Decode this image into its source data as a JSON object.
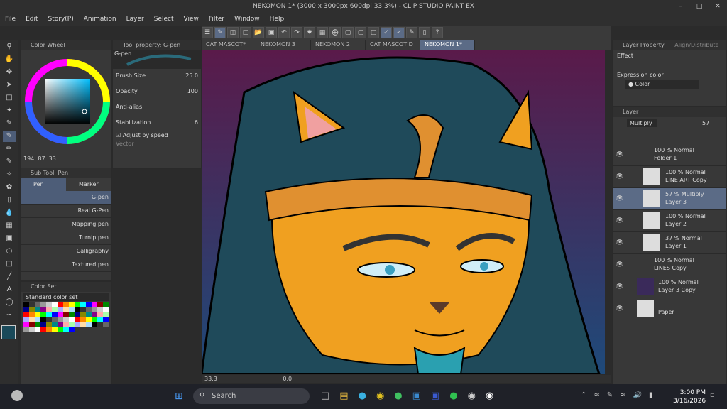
{
  "window": {
    "title": "NEKOMON 1* (3000 x 3000px 600dpi 33.3%) - CLIP STUDIO PAINT EX"
  },
  "menu": [
    "File",
    "Edit",
    "Story(P)",
    "Animation",
    "Layer",
    "Select",
    "View",
    "Filter",
    "Window",
    "Help"
  ],
  "tabs": [
    {
      "label": "CAT MASCOT*",
      "active": false
    },
    {
      "label": "NEKOMON 3",
      "active": false
    },
    {
      "label": "NEKOMON 2",
      "active": false
    },
    {
      "label": "CAT MASCOT D",
      "active": false
    },
    {
      "label": "NEKOMON 1*",
      "active": true
    }
  ],
  "color_wheel": {
    "title": "Color Wheel",
    "h": "194",
    "s": "87",
    "v": "33"
  },
  "tool_property": {
    "title": "Tool property: G-pen",
    "brush_name": "G-pen",
    "brush_size_label": "Brush Size",
    "brush_size_value": "25.0",
    "opacity_label": "Opacity",
    "opacity_value": "100",
    "anti_label": "Anti-aliasi",
    "stab_label": "Stabilization",
    "stab_value": "6",
    "adjust_label": "Adjust by speed",
    "vector_label": "Vector"
  },
  "sub_tool": {
    "title": "Sub Tool: Pen",
    "tab_pen": "Pen",
    "tab_marker": "Marker",
    "items": [
      "G-pen",
      "Real G-Pen",
      "Mapping pen",
      "Turnip pen",
      "Calligraphy",
      "Textured pen"
    ]
  },
  "color_set": {
    "title": "Color Set",
    "selected": "Standard color set"
  },
  "layer_property": {
    "title": "Layer Property",
    "tab2": "Align/Distribute",
    "effect_label": "Effect",
    "expression_label": "Expression color",
    "expression_value": "Color"
  },
  "layer_panel": {
    "title": "Layer",
    "blend_mode": "Multiply",
    "opacity": "57",
    "layers": [
      {
        "line1": "100 % Normal",
        "line2": "Folder 1",
        "type": "folder",
        "selected": false
      },
      {
        "line1": "100 % Normal",
        "line2": "LINE ART Copy",
        "type": "raster",
        "selected": false
      },
      {
        "line1": "57 % Multiply",
        "line2": "Layer 3",
        "type": "raster",
        "selected": true
      },
      {
        "line1": "100 % Normal",
        "line2": "Layer 2",
        "type": "raster",
        "selected": false
      },
      {
        "line1": "37 % Normal",
        "line2": "Layer 1",
        "type": "raster",
        "selected": false
      },
      {
        "line1": "100 % Normal",
        "line2": "LINES Copy",
        "type": "folder",
        "selected": false
      },
      {
        "line1": "100 % Normal",
        "line2": "Layer 3 Copy",
        "type": "raster",
        "selected": false
      },
      {
        "line1": "",
        "line2": "Paper",
        "type": "paper",
        "selected": false
      }
    ]
  },
  "status": {
    "zoom": "33.3",
    "coord": "0.0"
  },
  "taskbar": {
    "search_placeholder": "Search",
    "time": "3:00 PM",
    "date": "3/16/2026"
  },
  "colors": {
    "accent": "#5b6b86",
    "bg": "#383838",
    "canvas_top": "#5a1a4a",
    "canvas_bottom": "#1e4a7a"
  }
}
